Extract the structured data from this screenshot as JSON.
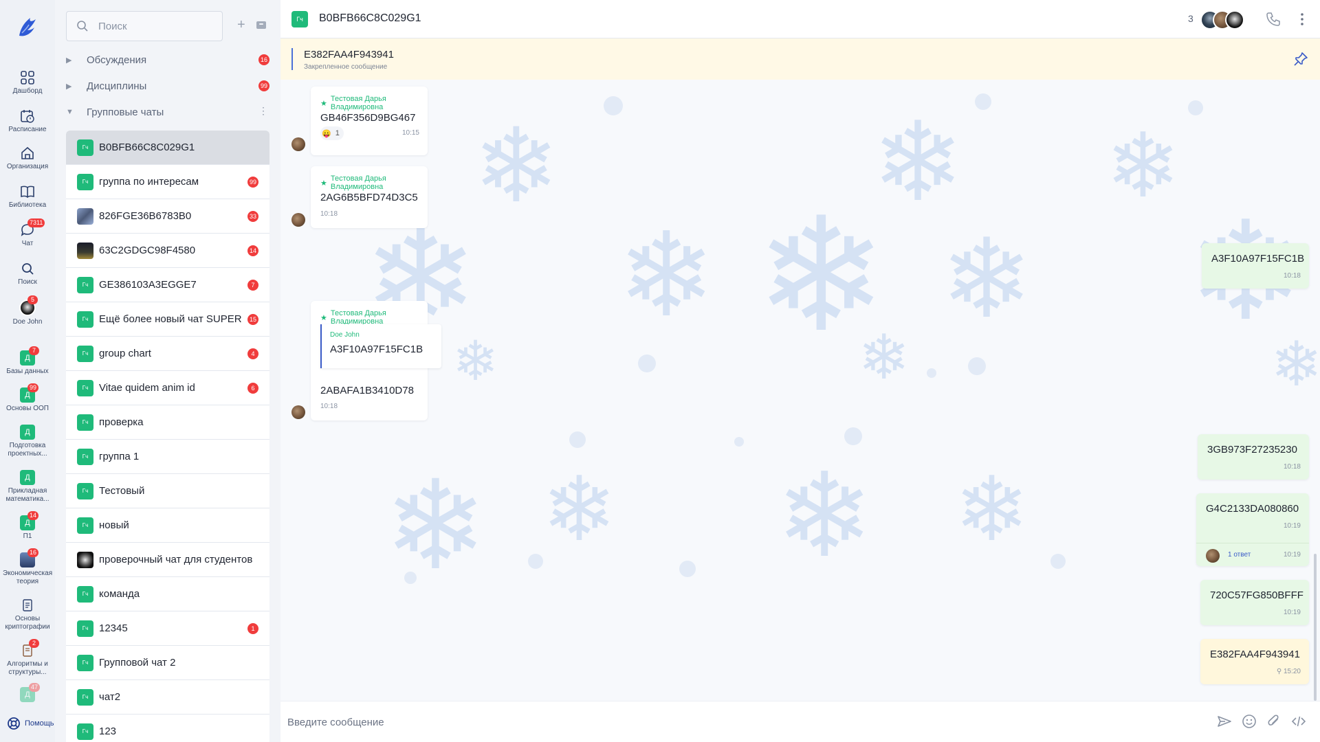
{
  "rail": {
    "items": [
      {
        "label": "Дашборд",
        "icon": "dashboard-icon"
      },
      {
        "label": "Расписание",
        "icon": "calendar-icon"
      },
      {
        "label": "Организация",
        "icon": "home-icon"
      },
      {
        "label": "Библиотека",
        "icon": "book-icon"
      },
      {
        "label": "Чат",
        "icon": "chat-icon",
        "badge": "7311"
      },
      {
        "label": "Поиск",
        "icon": "search-icon"
      },
      {
        "label": "Doe John",
        "icon": "user-avatar",
        "badge": "5"
      },
      {
        "label": "Базы данных",
        "icon": "course-tile",
        "tile": "Д",
        "badge": "7"
      },
      {
        "label": "Основы ООП",
        "icon": "course-tile",
        "tile": "Д",
        "badge": "99"
      },
      {
        "label": "Подготовка проектных...",
        "icon": "course-tile",
        "tile": "Д"
      },
      {
        "label": "Прикладная математика...",
        "icon": "course-tile",
        "tile": "Д"
      },
      {
        "label": "П1",
        "icon": "course-tile",
        "tile": "Д",
        "badge": "14"
      },
      {
        "label": "Экономическая теория",
        "icon": "course-photo",
        "badge": "16"
      },
      {
        "label": "Основы криптографии",
        "icon": "document-icon"
      },
      {
        "label": "Алгоритмы и структуры...",
        "icon": "document-icon",
        "badge": "2"
      },
      {
        "label": "",
        "icon": "course-tile",
        "tile": "Д",
        "badge": "47"
      }
    ],
    "help_label": "Помощь"
  },
  "list": {
    "search_placeholder": "Поиск",
    "sections": [
      {
        "label": "Обсуждения",
        "badge": "16"
      },
      {
        "label": "Дисциплины",
        "badge": "99"
      },
      {
        "label": "Групповые чаты"
      }
    ],
    "chats": [
      {
        "name": "B0BFB66C8C029G1",
        "tile": "Гч",
        "active": true
      },
      {
        "name": "группа по интересам",
        "tile": "Гч",
        "badge": "99"
      },
      {
        "name": "826FGE36B6783B0",
        "tile": "",
        "badge": "33"
      },
      {
        "name": "63C2GDGC98F4580",
        "tile": "",
        "badge": "14"
      },
      {
        "name": "GE386103A3EGGE7",
        "tile": "Гч",
        "badge": "7"
      },
      {
        "name": "Ещё более новый чат SUPER",
        "tile": "Гч",
        "badge": "15"
      },
      {
        "name": "group chart",
        "tile": "Гч",
        "badge": "4"
      },
      {
        "name": "Vitae quidem anim id",
        "tile": "Гч",
        "badge": "6"
      },
      {
        "name": "проверка",
        "tile": "Гч"
      },
      {
        "name": "группа 1",
        "tile": "Гч"
      },
      {
        "name": "Тестовый",
        "tile": "Гч"
      },
      {
        "name": "новый",
        "tile": "Гч"
      },
      {
        "name": "проверочный чат для студентов",
        "tile": ""
      },
      {
        "name": "команда",
        "tile": "Гч"
      },
      {
        "name": "12345",
        "tile": "Гч",
        "badge": "1"
      },
      {
        "name": "Групповой чат 2",
        "tile": "Гч"
      },
      {
        "name": "чат2",
        "tile": "Гч"
      },
      {
        "name": "123",
        "tile": "Гч"
      }
    ]
  },
  "header": {
    "tile": "Гч",
    "title": "B0BFB66C8C029G1",
    "members_count": "3"
  },
  "pinned": {
    "text": "E382FAA4F943941",
    "label": "Закрепленное сообщение"
  },
  "messages": [
    {
      "author": "Тестовая Дарья Владимировна",
      "text": "GB46F356D9BG467",
      "time": "10:15",
      "reaction_emoji": "😛",
      "reaction_count": "1"
    },
    {
      "author": "Тестовая Дарья Владимировна",
      "text": "2AG6B5BFD74D3C5",
      "time": "10:18"
    },
    {
      "text": "A3F10A97F15FC1B",
      "time": "10:18"
    },
    {
      "author": "Тестовая Дарья Владимировна",
      "quote_author": "Doe John",
      "quote_text": "A3F10A97F15FC1B",
      "text": "2ABAFA1B3410D78",
      "time": "10:18"
    },
    {
      "text": "3GB973F27235230",
      "time": "10:18"
    },
    {
      "text": "G4C2133DA080860",
      "time": "10:19",
      "reply_label": "1 ответ",
      "reply_time": "10:19"
    },
    {
      "text": "720C57FG850BFFF",
      "time": "10:19"
    },
    {
      "text": "E382FAA4F943941",
      "time": "15:20"
    }
  ],
  "composer": {
    "placeholder": "Введите сообщение"
  },
  "colors": {
    "accent_green": "#1fba7a",
    "badge_red": "#f03c3c",
    "outgoing_bubble": "#e7f8e6",
    "pinned_bg": "#fff9e6",
    "link_blue": "#3a5bc8"
  }
}
